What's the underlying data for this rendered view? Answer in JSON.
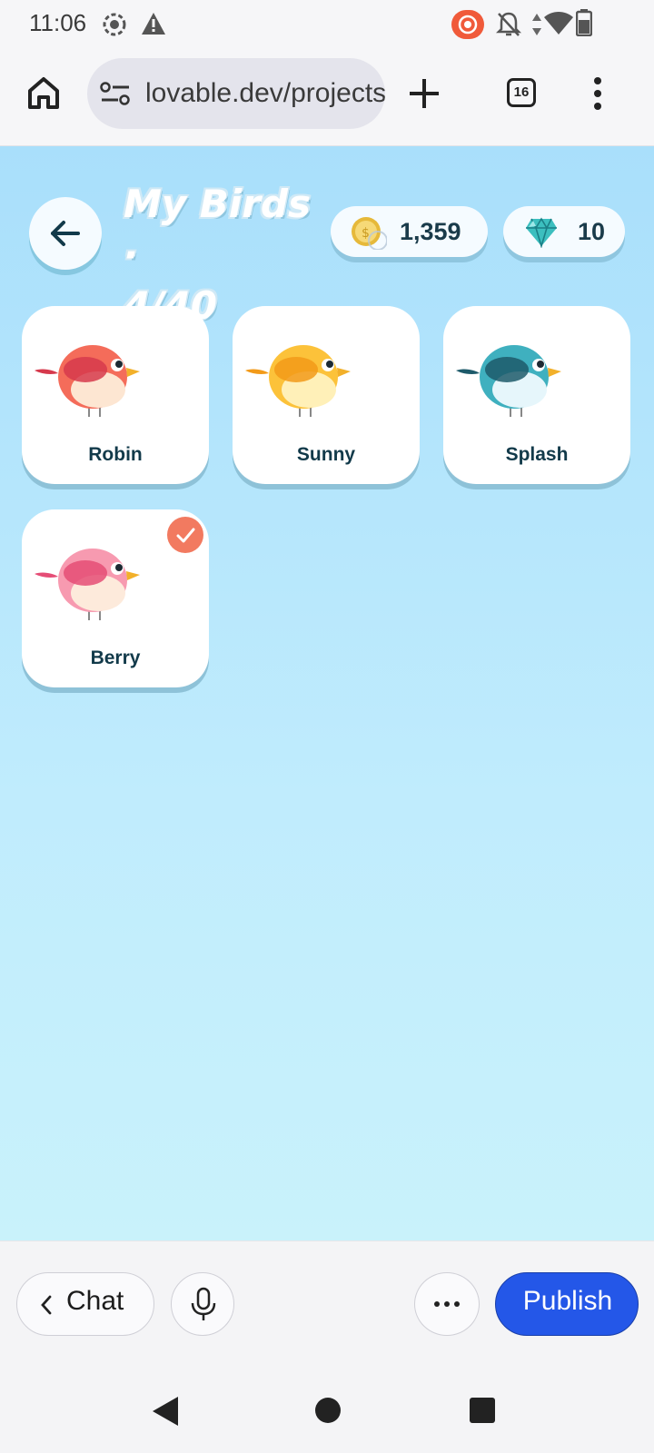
{
  "status_bar": {
    "time": "11:06",
    "icons": [
      "screen-record-icon",
      "warning-icon",
      "cast-icon",
      "notifications-off-icon",
      "data-arrows-icon",
      "wifi-icon",
      "battery-icon"
    ]
  },
  "browser": {
    "url": "lovable.dev/projects",
    "tab_count": "16",
    "icons": [
      "home-icon",
      "site-settings-icon",
      "new-tab-icon",
      "tab-switcher-icon",
      "overflow-menu-icon"
    ]
  },
  "game": {
    "title_line1": "My Birds ·",
    "title_line2": "4/40",
    "coins": "1,359",
    "gems": "10",
    "birds": [
      {
        "name": "Robin",
        "body": "#f46c5a",
        "belly": "#fde6d2",
        "wing": "#d6394c",
        "tail": "#d6394c",
        "selected": false
      },
      {
        "name": "Sunny",
        "body": "#fcc23a",
        "belly": "#fff0b8",
        "wing": "#f29a19",
        "tail": "#f29a19",
        "selected": false
      },
      {
        "name": "Splash",
        "body": "#3fb0bf",
        "belly": "#e6f6fb",
        "wing": "#1d5a6a",
        "tail": "#1d5a6a",
        "selected": false
      },
      {
        "name": "Berry",
        "body": "#f79ab0",
        "belly": "#fdeadb",
        "wing": "#e54d76",
        "tail": "#e54d76",
        "selected": true
      }
    ]
  },
  "toolbar": {
    "chat_label": "Chat",
    "publish_label": "Publish"
  },
  "colors": {
    "publish": "#2457e8",
    "check_badge": "#f27a60",
    "sky_top": "#a9dffb",
    "sky_bottom": "#c9f2fb"
  }
}
